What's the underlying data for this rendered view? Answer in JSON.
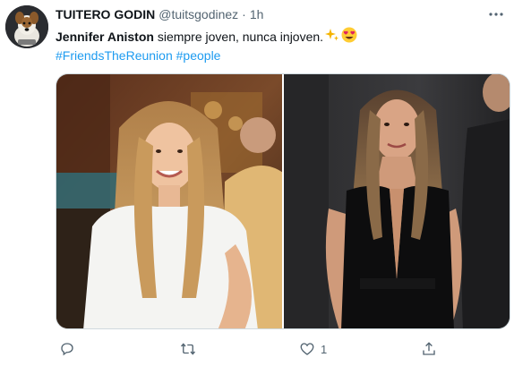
{
  "tweet": {
    "author_name": "TUITERO GODIN",
    "handle": "@tuitsgodinez",
    "separator": "·",
    "time": "1h",
    "text_bold": "Jennifer Aniston",
    "text_rest": " siempre joven, nunca injoven.",
    "hashtags": [
      "#FriendsTheReunion",
      "#people"
    ]
  },
  "actions": {
    "reply_count": "",
    "retweet_count": "",
    "like_count": "1"
  },
  "icons": {
    "more": "more-horizontal-icon",
    "sparkles": "sparkles-emoji",
    "heart_eyes": "heart-eyes-emoji",
    "reply": "reply-icon",
    "retweet": "retweet-icon",
    "like": "heart-icon",
    "share": "share-icon"
  },
  "colors": {
    "accent": "#1d9bf0",
    "muted": "#536471",
    "text": "#0f1419",
    "border": "#cfd9de"
  }
}
